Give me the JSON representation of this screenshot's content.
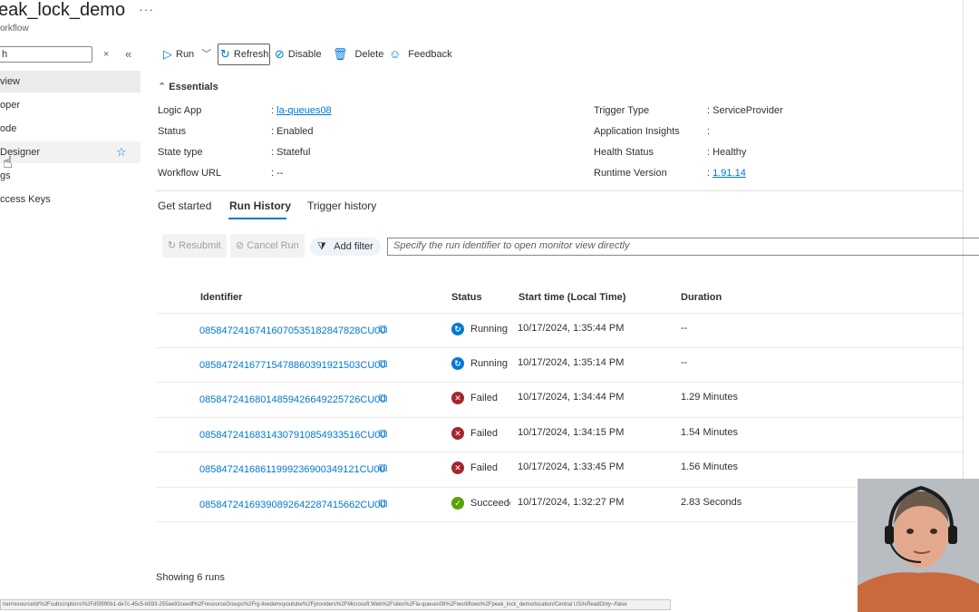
{
  "header": {
    "title": "eak_lock_demo",
    "subtitle": "orkflow",
    "more": "···"
  },
  "sidebar": {
    "search_value": "h",
    "close": "×",
    "collapse": "«",
    "items": [
      {
        "label": "view",
        "active": true
      },
      {
        "label": "oper"
      },
      {
        "label": "ode"
      },
      {
        "label": "Designer",
        "hover": true
      },
      {
        "label": "gs"
      },
      {
        "label": "ccess Keys"
      }
    ],
    "star": "☆"
  },
  "toolbar": {
    "run": "Run",
    "refresh": "Refresh",
    "disable": "Disable",
    "delete": "Delete",
    "feedback": "Feedback"
  },
  "essentials": {
    "heading": "Essentials",
    "left": [
      {
        "label": "Logic App",
        "value": "la-queues08",
        "link": true
      },
      {
        "label": "Status",
        "value": "Enabled"
      },
      {
        "label": "State type",
        "value": "Stateful"
      },
      {
        "label": "Workflow URL",
        "value": "--"
      }
    ],
    "right": [
      {
        "label": "Trigger Type",
        "value": "ServiceProvider"
      },
      {
        "label": "Application Insights",
        "value": ""
      },
      {
        "label": "Health Status",
        "value": "Healthy"
      },
      {
        "label": "Runtime Version",
        "value": "1.91.14",
        "link": true
      }
    ]
  },
  "tabs": [
    "Get started",
    "Run History",
    "Trigger history"
  ],
  "actions": {
    "resubmit": "Resubmit",
    "cancel_run": "Cancel Run",
    "add_filter": "Add filter",
    "run_input_placeholder": "Specify the run identifier to open monitor view directly"
  },
  "table": {
    "headers": [
      "Identifier",
      "Status",
      "Start time (Local Time)",
      "Duration"
    ],
    "rows": [
      {
        "id": "08584724167416070535182847828CU00",
        "status": "Running",
        "time": "10/17/2024, 1:35:44 PM",
        "duration": "--"
      },
      {
        "id": "08584724167715478860391921503CU00",
        "status": "Running",
        "time": "10/17/2024, 1:35:14 PM",
        "duration": "--"
      },
      {
        "id": "08584724168014859426649225726CU00",
        "status": "Failed",
        "time": "10/17/2024, 1:34:44 PM",
        "duration": "1.29 Minutes"
      },
      {
        "id": "08584724168314307910854933516CU00",
        "status": "Failed",
        "time": "10/17/2024, 1:34:15 PM",
        "duration": "1.54 Minutes"
      },
      {
        "id": "08584724168611999236900349121CU00",
        "status": "Failed",
        "time": "10/17/2024, 1:33:45 PM",
        "duration": "1.56 Minutes"
      },
      {
        "id": "08584724169390892642287415662CU00",
        "status": "Succeeded",
        "time": "10/17/2024, 1:32:27 PM",
        "duration": "2.83 Seconds"
      }
    ],
    "footer": "Showing 6 runs"
  },
  "statusbar_url": "ner/resourceId/%2Fsubscriptions%2Fd5f990b1-de7c-45c5-b593-255ee92ceedf%2FresourceGroups%2Frg-livedemoyoutube%2Fproviders%2FMicrosoft.Web%2Fsites%2Fla-queues08%2Fworkflows%2Fpeak_lock_demo/location/Central US/isReadOnly~/false",
  "colors": {
    "accent": "#0078d4",
    "running": "#0078d4",
    "failed": "#a4262c",
    "succeeded": "#57a300"
  }
}
